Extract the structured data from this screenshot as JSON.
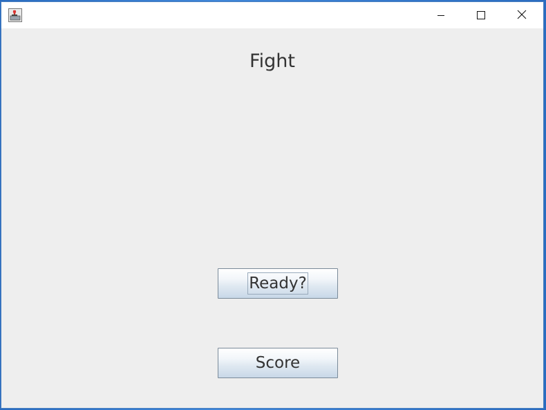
{
  "window": {
    "controls": {
      "minimize_icon": "minimize-icon",
      "maximize_icon": "maximize-icon",
      "close_icon": "close-icon"
    }
  },
  "main": {
    "title": "Fight",
    "ready_button_label": "Ready?",
    "score_button_label": "Score"
  },
  "colors": {
    "background": "#eeeeee",
    "text": "#333333",
    "button_border": "#7a8a99"
  }
}
